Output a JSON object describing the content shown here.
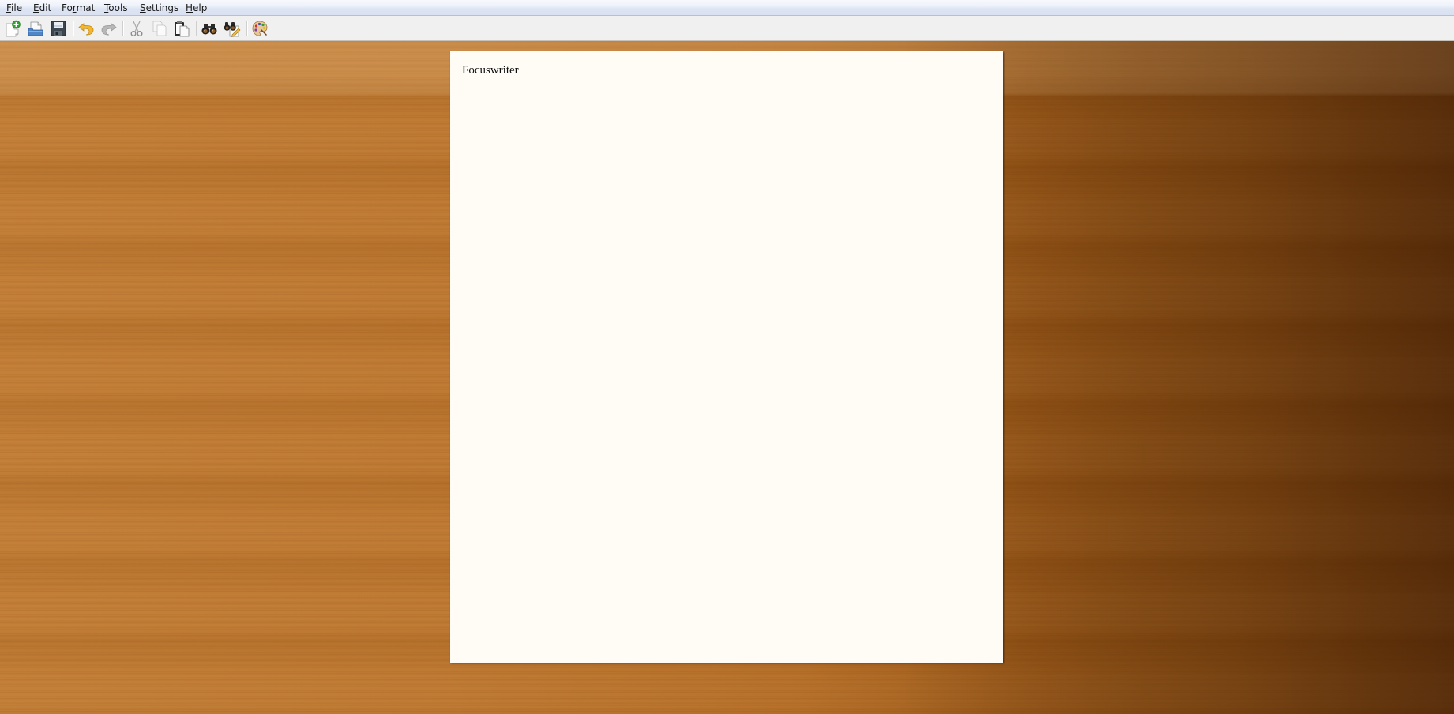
{
  "app": {
    "name": "FocusWriter"
  },
  "menubar": {
    "items": [
      {
        "id": "file",
        "label_pre": "",
        "mnemonic": "F",
        "label_post": "ile"
      },
      {
        "id": "edit",
        "label_pre": "",
        "mnemonic": "E",
        "label_post": "dit"
      },
      {
        "id": "format",
        "label_pre": "Fo",
        "mnemonic": "r",
        "label_post": "mat"
      },
      {
        "id": "tools",
        "label_pre": "",
        "mnemonic": "T",
        "label_post": "ools"
      },
      {
        "id": "settings",
        "label_pre": "",
        "mnemonic": "S",
        "label_post": "ettings"
      },
      {
        "id": "help",
        "label_pre": "",
        "mnemonic": "H",
        "label_post": "elp"
      }
    ]
  },
  "toolbar": {
    "buttons": [
      {
        "id": "new",
        "icon": "new-document-icon",
        "tooltip": "New",
        "enabled": true
      },
      {
        "id": "open",
        "icon": "open-folder-icon",
        "tooltip": "Open",
        "enabled": true
      },
      {
        "id": "save",
        "icon": "save-floppy-icon",
        "tooltip": "Save",
        "enabled": true
      },
      {
        "id": "undo",
        "icon": "undo-icon",
        "tooltip": "Undo",
        "enabled": true
      },
      {
        "id": "redo",
        "icon": "redo-icon",
        "tooltip": "Redo",
        "enabled": false
      },
      {
        "id": "cut",
        "icon": "scissors-icon",
        "tooltip": "Cut",
        "enabled": false
      },
      {
        "id": "copy",
        "icon": "copy-icon",
        "tooltip": "Copy",
        "enabled": false
      },
      {
        "id": "paste",
        "icon": "paste-clipboard-icon",
        "tooltip": "Paste",
        "enabled": true
      },
      {
        "id": "find",
        "icon": "binoculars-icon",
        "tooltip": "Find",
        "enabled": true
      },
      {
        "id": "replace",
        "icon": "find-replace-icon",
        "tooltip": "Replace",
        "enabled": true
      },
      {
        "id": "themes",
        "icon": "palette-icon",
        "tooltip": "Themes",
        "enabled": true
      }
    ]
  },
  "document": {
    "text": "Focuswriter"
  },
  "colors": {
    "page_background": "#fffcf5",
    "text": "#111111",
    "wood_light": "#c07c34",
    "wood_dark": "#6e3a0c"
  }
}
